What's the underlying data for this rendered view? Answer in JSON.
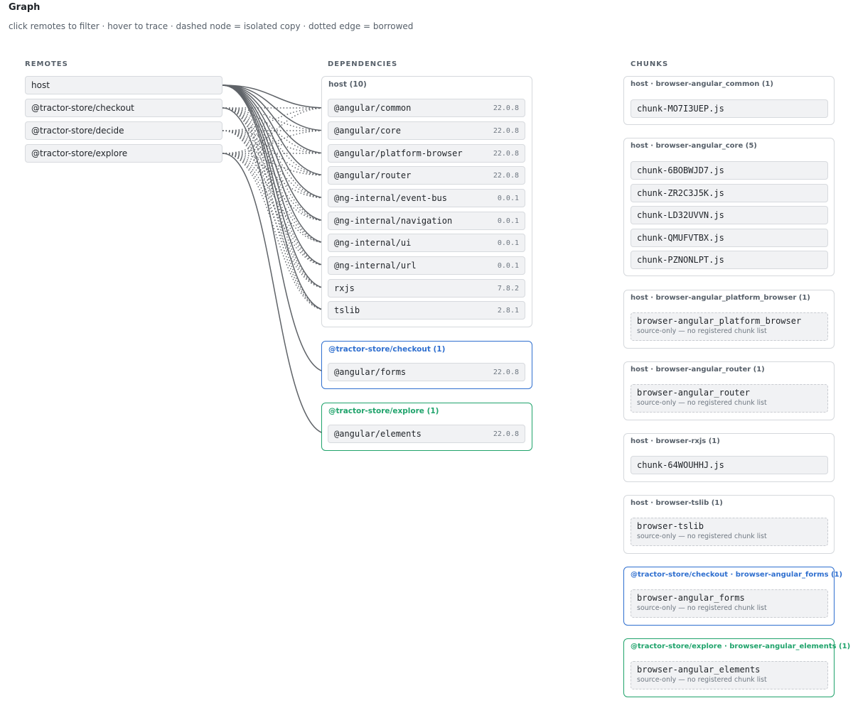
{
  "header": {
    "title": "Graph",
    "subtitle": "click remotes to filter · hover to trace · dashed node = isolated copy · dotted edge = borrowed"
  },
  "columns": {
    "remotes": "REMOTES",
    "dependencies": "DEPENDENCIES",
    "chunks": "CHUNKS"
  },
  "remotes": [
    {
      "label": "host"
    },
    {
      "label": "@tractor-store/checkout"
    },
    {
      "label": "@tractor-store/decide"
    },
    {
      "label": "@tractor-store/explore"
    }
  ],
  "dependency_groups": [
    {
      "label": "host (10)",
      "deps": [
        {
          "name": "@angular/common",
          "version": "22.0.8"
        },
        {
          "name": "@angular/core",
          "version": "22.0.8"
        },
        {
          "name": "@angular/platform-browser",
          "version": "22.0.8"
        },
        {
          "name": "@angular/router",
          "version": "22.0.8"
        },
        {
          "name": "@ng-internal/event-bus",
          "version": "0.0.1"
        },
        {
          "name": "@ng-internal/navigation",
          "version": "0.0.1"
        },
        {
          "name": "@ng-internal/ui",
          "version": "0.0.1"
        },
        {
          "name": "@ng-internal/url",
          "version": "0.0.1"
        },
        {
          "name": "rxjs",
          "version": "7.8.2"
        },
        {
          "name": "tslib",
          "version": "2.8.1"
        }
      ]
    },
    {
      "label": "@tractor-store/checkout (1)",
      "deps": [
        {
          "name": "@angular/forms",
          "version": "22.0.8"
        }
      ]
    },
    {
      "label": "@tractor-store/explore (1)",
      "deps": [
        {
          "name": "@angular/elements",
          "version": "22.0.8"
        }
      ]
    }
  ],
  "chunk_groups": [
    {
      "label": "host · browser-angular_common (1)",
      "chunks": [
        {
          "name": "chunk-MO7I3UEP.js"
        }
      ]
    },
    {
      "label": "host · browser-angular_core (5)",
      "chunks": [
        {
          "name": "chunk-6BOBWJD7.js"
        },
        {
          "name": "chunk-ZR2C3J5K.js"
        },
        {
          "name": "chunk-LD32UVVN.js"
        },
        {
          "name": "chunk-QMUFVTBX.js"
        },
        {
          "name": "chunk-PZNONLPT.js"
        }
      ]
    },
    {
      "label": "host · browser-angular_platform_browser (1)",
      "chunks": [
        {
          "name": "browser-angular_platform_browser",
          "note": "source-only — no registered chunk list"
        }
      ]
    },
    {
      "label": "host · browser-angular_router (1)",
      "chunks": [
        {
          "name": "browser-angular_router",
          "note": "source-only — no registered chunk list"
        }
      ]
    },
    {
      "label": "host · browser-rxjs (1)",
      "chunks": [
        {
          "name": "chunk-64WOUHHJ.js"
        }
      ]
    },
    {
      "label": "host · browser-tslib (1)",
      "chunks": [
        {
          "name": "browser-tslib",
          "note": "source-only — no registered chunk list"
        }
      ]
    },
    {
      "label": "@tractor-store/checkout · browser-angular_forms (1)",
      "chunks": [
        {
          "name": "browser-angular_forms",
          "note": "source-only — no registered chunk list"
        }
      ]
    },
    {
      "label": "@tractor-store/explore · browser-angular_elements (1)",
      "chunks": [
        {
          "name": "browser-angular_elements",
          "note": "source-only — no registered chunk list"
        }
      ]
    }
  ],
  "colors": {
    "edge": "#5f6368",
    "checkout_accent": "#2f6fcf",
    "explore_accent": "#1fa36b"
  }
}
